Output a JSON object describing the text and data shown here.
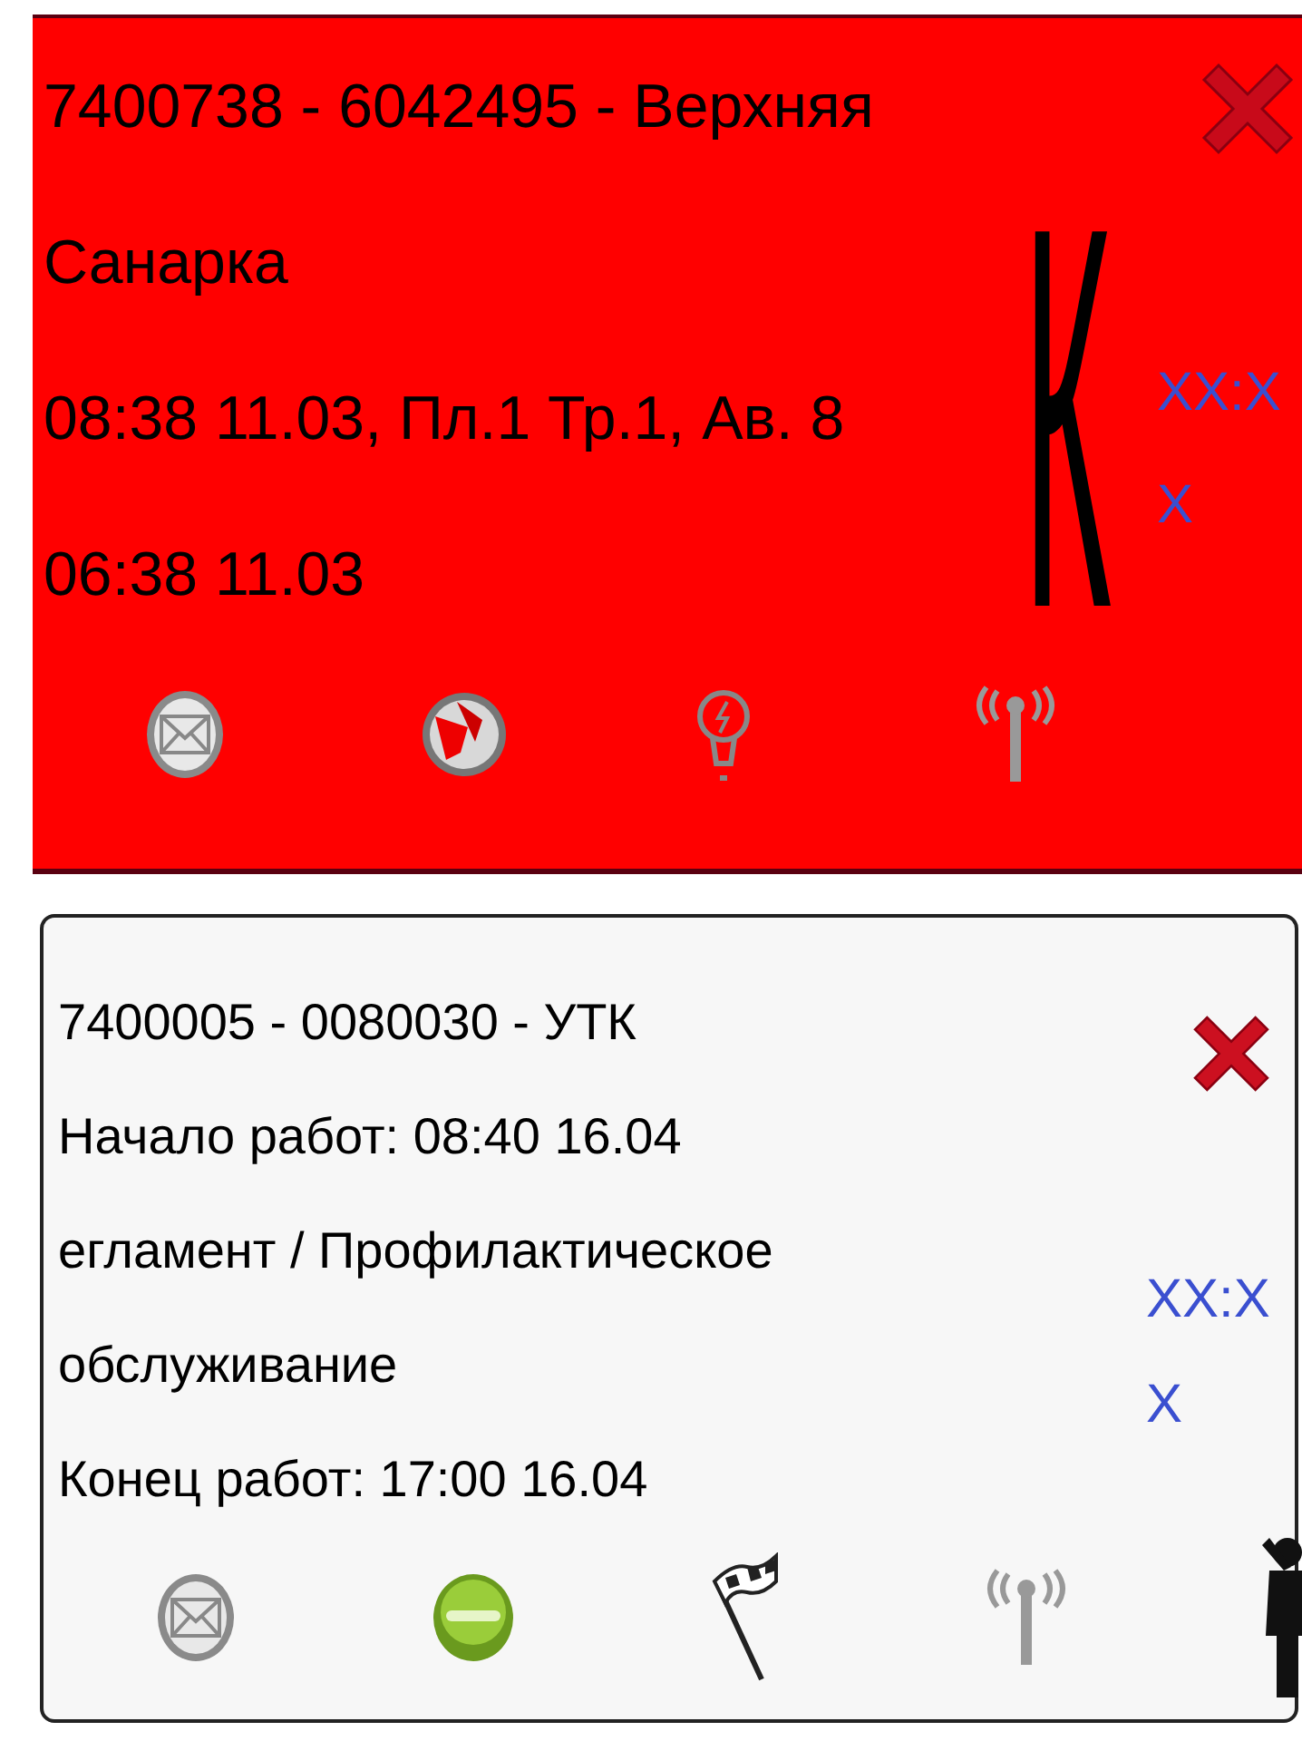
{
  "cards": [
    {
      "highlighted": true,
      "lines": [
        "7400738 - 6042495 - Верхняя Санарка",
        "08:38 11.03, Пл.1 Тр.1, Ав. 8",
        "06:38 11.03"
      ],
      "letter": "К",
      "time": "XX:XX",
      "actions": [
        {
          "kind": "mail"
        },
        {
          "kind": "globe"
        },
        {
          "kind": "bulb"
        },
        {
          "kind": "antenna"
        }
      ]
    },
    {
      "highlighted": false,
      "lines": [
        "7400005 - 0080030 - УТК",
        "Начало работ: 08:40 16.04",
        "егламент / Профилактическое обслуживание",
        "Конец работ: 17:00 16.04"
      ],
      "time": "XX:XX",
      "actions": [
        {
          "kind": "mail"
        },
        {
          "kind": "start"
        },
        {
          "kind": "flag"
        },
        {
          "kind": "antenna"
        },
        {
          "kind": "person"
        }
      ]
    }
  ]
}
